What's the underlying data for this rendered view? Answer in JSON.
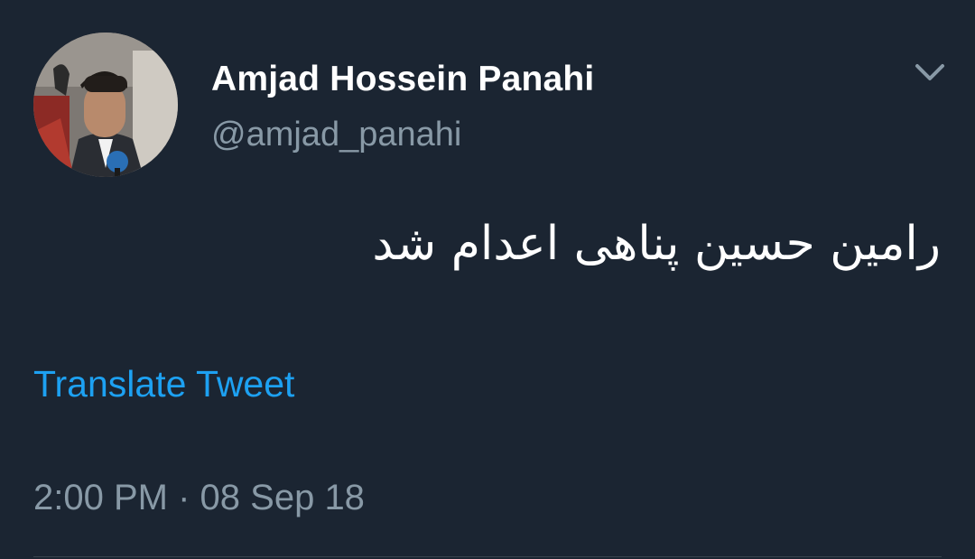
{
  "tweet": {
    "author": {
      "display_name": "Amjad Hossein Panahi",
      "handle": "@amjad_panahi",
      "avatar_icon": "profile-photo"
    },
    "menu_icon": "chevron-down-icon",
    "text": "رامین حسین پناهی اعدام شد",
    "translate_label": "Translate Tweet",
    "time": "2:00 PM",
    "separator": "·",
    "date": "08 Sep 18"
  },
  "colors": {
    "background": "#1b2532",
    "primary_text": "#ffffff",
    "secondary_text": "#8899a6",
    "link": "#1da1f2",
    "divider": "#38444d"
  }
}
